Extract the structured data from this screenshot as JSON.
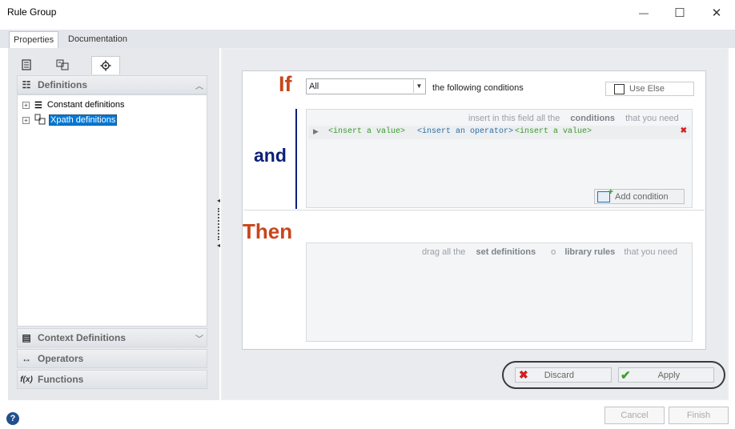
{
  "window": {
    "title": "Rule Group",
    "minimize_glyph": "—",
    "maximize_glyph": "☐",
    "close_glyph": "✕"
  },
  "tabs": [
    {
      "label": "Properties",
      "active": true
    },
    {
      "label": "Documentation",
      "active": false
    }
  ],
  "left_panel": {
    "icon_tabs": [
      "document-icon",
      "tree-icon",
      "gear-icon"
    ],
    "sections": {
      "definitions": "Definitions",
      "context_definitions": "Context Definitions",
      "operators": "Operators",
      "functions": "Functions"
    },
    "tree_items": [
      {
        "label": "Constant definitions",
        "icon": "list-icon",
        "selected": false
      },
      {
        "label": "Xpath definitions",
        "icon": "xpath-icon",
        "selected": true
      }
    ]
  },
  "rule": {
    "if_label": "If",
    "and_label": "and",
    "then_label": "Then",
    "condition_select": "All",
    "following_conditions": "the following conditions",
    "use_else_label": "Use Else",
    "use_else_checked": false,
    "conditions_hint": {
      "prefix": "insert in this field all the",
      "bold": "conditions",
      "suffix": "that you need"
    },
    "condition_row": {
      "value1": "<insert a value>",
      "operator": "<insert an operator>",
      "value2": "<insert a value>"
    },
    "add_condition_label": "Add condition",
    "then_hint": {
      "prefix": "drag all the",
      "bold1": "set definitions",
      "middle": "o",
      "bold2": "library rules",
      "suffix": "that you need"
    }
  },
  "actions": {
    "discard_label": "Discard",
    "apply_label": "Apply"
  },
  "footer": {
    "cancel_label": "Cancel",
    "finish_label": "Finish"
  },
  "colors": {
    "if_color": "#c8461b",
    "and_color": "#0d1f7a",
    "then_color": "#c8461b",
    "value_green": "#3a9a2c",
    "operator_blue": "#2a6fa8",
    "selection_blue": "#0078d7"
  }
}
